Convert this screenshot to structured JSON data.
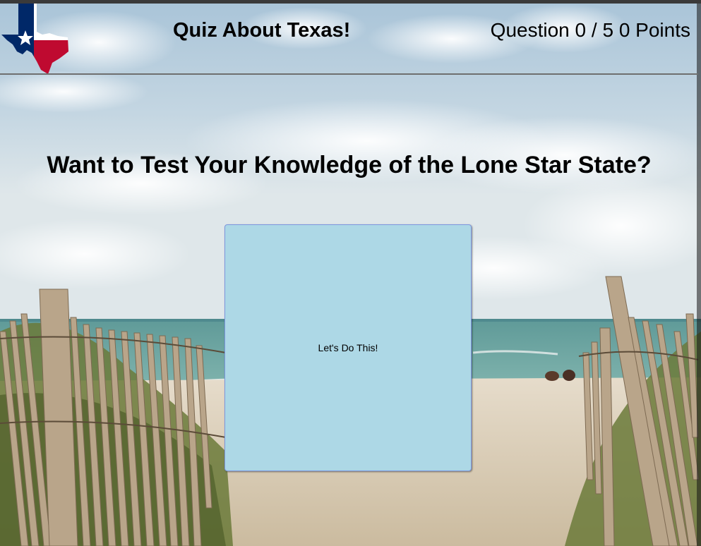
{
  "header": {
    "title": "Quiz About Texas!",
    "progress": {
      "question_label": "Question",
      "current": "0",
      "separator": "/",
      "total": "5",
      "points": "0",
      "points_label": "Points"
    },
    "logo_icon": "texas-flag-map-icon"
  },
  "main": {
    "headline": "Want to Test Your Knowledge of the Lone Star State?",
    "start_button_label": "Let's Do This!"
  },
  "colors": {
    "start_button_bg": "#add8e6",
    "start_button_border": "#7d97e0",
    "header_rule": "#6f6f6f",
    "flag_blue": "#002868",
    "flag_red": "#bf0a30"
  }
}
